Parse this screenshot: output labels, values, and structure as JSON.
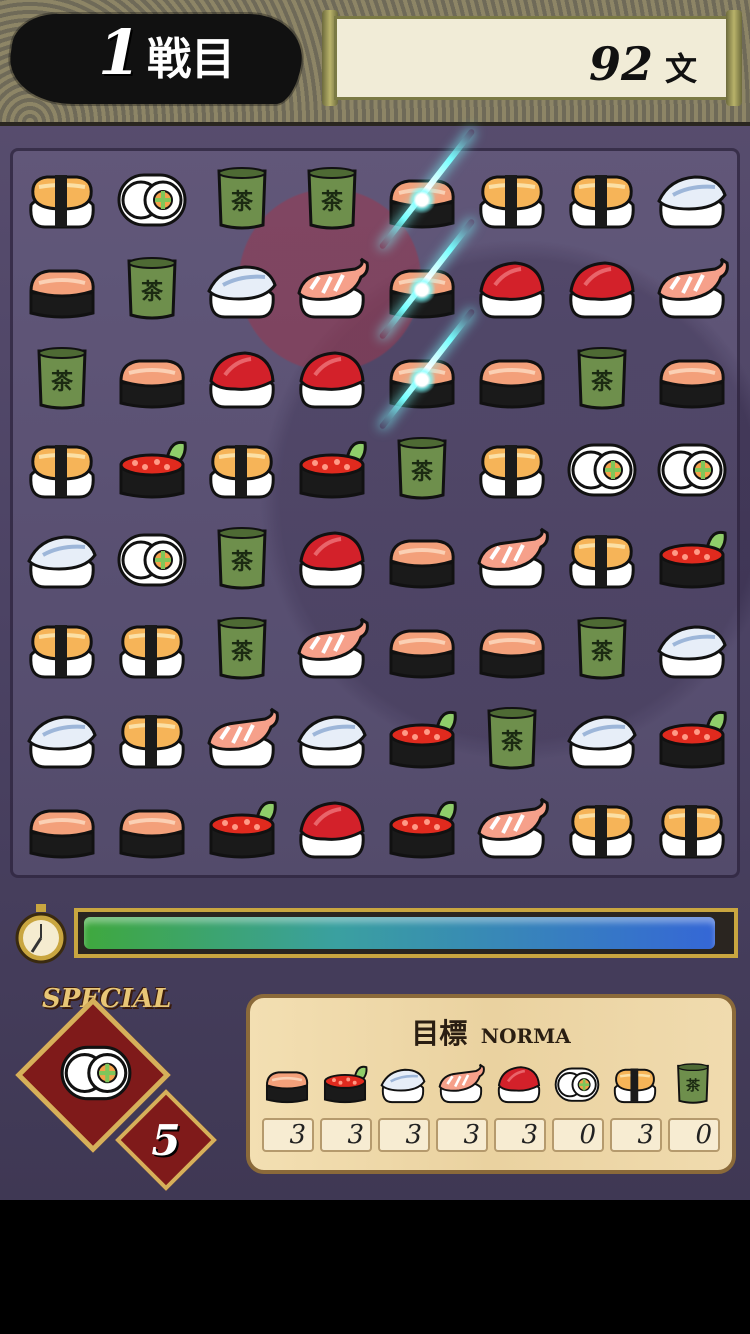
{
  "header": {
    "round_number": "1",
    "round_suffix": "戦目",
    "score_value": "92",
    "score_unit": "文"
  },
  "board": {
    "rows": [
      [
        "tamago",
        "roll",
        "tea",
        "tea",
        "salmon",
        "tamago",
        "tamago",
        "white"
      ],
      [
        "salmon",
        "tea",
        "white",
        "shrimp",
        "salmon",
        "tuna",
        "tuna",
        "shrimp"
      ],
      [
        "tea",
        "salmon",
        "tuna",
        "tuna",
        "salmon",
        "salmon",
        "tea",
        "salmon"
      ],
      [
        "tamago",
        "ikura",
        "tamago",
        "ikura",
        "tea",
        "tamago",
        "roll",
        "roll"
      ],
      [
        "white",
        "roll",
        "tea",
        "tuna",
        "salmon",
        "shrimp",
        "tamago",
        "ikura"
      ],
      [
        "tamago",
        "tamago",
        "tea",
        "shrimp",
        "salmon",
        "salmon",
        "tea",
        "white"
      ],
      [
        "white",
        "tamago",
        "shrimp",
        "white",
        "ikura",
        "tea",
        "white",
        "ikura"
      ],
      [
        "salmon",
        "salmon",
        "ikura",
        "tuna",
        "ikura",
        "shrimp",
        "tamago",
        "tamago"
      ]
    ],
    "highlight_column": 4,
    "highlight_rows": [
      0,
      1,
      2
    ]
  },
  "timer": {
    "remaining_fraction": 0.97
  },
  "special": {
    "label": "SPECIAL",
    "piece": "roll",
    "count": "5"
  },
  "target": {
    "title_jp": "目標",
    "title_en": "NORMA",
    "items": [
      {
        "piece": "salmon",
        "count": "3"
      },
      {
        "piece": "ikura",
        "count": "3"
      },
      {
        "piece": "white",
        "count": "3"
      },
      {
        "piece": "shrimp",
        "count": "3"
      },
      {
        "piece": "tuna",
        "count": "3"
      },
      {
        "piece": "roll",
        "count": "0"
      },
      {
        "piece": "tamago",
        "count": "3"
      },
      {
        "piece": "tea",
        "count": "0"
      }
    ]
  },
  "colors": {
    "timer_start": "#3fa83e",
    "timer_end": "#3567d6",
    "special_bg": "#7f1a1a",
    "gold": "#d6b05a"
  }
}
